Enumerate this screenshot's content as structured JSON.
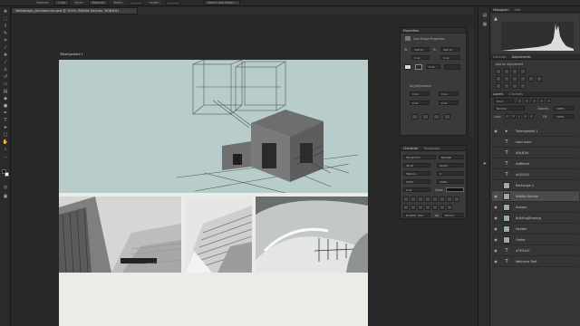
{
  "options_bar": {
    "items": [
      "Feather:",
      "0 px",
      "Style:",
      "Normal",
      "Width:",
      "Height:",
      "Select and Mask..."
    ]
  },
  "document_tab": {
    "title": "Webdesign_Architecture.psd @ 100% (Middle Section, RGB/8#)"
  },
  "canvas": {
    "artboard_label": "Tekengebied 1"
  },
  "properties_panel": {
    "title": "Properties",
    "subtitle": "Live Shape Properties",
    "w_label": "W:",
    "w_value": "340 px",
    "h_label": "H:",
    "h_value": "402 px",
    "x_value": "0 px",
    "y_value": "0 px",
    "stroke_value": "0 px",
    "corner_label": "Any/all/corners",
    "corner_values": [
      "0 px",
      "0 px",
      "0 px",
      "0 px"
    ]
  },
  "character_panel": {
    "tabs": [
      "Character",
      "Paragraph"
    ],
    "font_family": "Myriad Pro",
    "font_style": "Regular",
    "font_size": "36 pt",
    "leading": "(Auto)",
    "kerning": "Metrics",
    "tracking": "0",
    "vertical_scale": "100%",
    "horizontal_scale": "100%",
    "baseline": "0 pt",
    "color_label": "Color:",
    "language": "English: USA",
    "antialias": "Strong",
    "aa_icon": "aa"
  },
  "histogram_panel": {
    "tabs": [
      "Histogram",
      "Info"
    ]
  },
  "libraries_panel": {
    "tabs": [
      "Libraries",
      "Adjustments"
    ],
    "add_label": "Add an adjustment"
  },
  "layers_panel": {
    "tabs": [
      "Layers",
      "Channels"
    ],
    "kind_label": "Kind",
    "blend_mode": "Normal",
    "opacity_label": "Opacity:",
    "opacity_value": "100%",
    "lock_label": "Lock:",
    "fill_label": "Fill:",
    "fill_value": "100%",
    "layers": [
      {
        "name": "Tekengebied 1",
        "type": "group",
        "visible": true
      },
      {
        "name": "read more",
        "type": "text",
        "visible": false
      },
      {
        "name": "#0L81M",
        "type": "text",
        "visible": false
      },
      {
        "name": "#offered",
        "type": "text",
        "visible": false
      },
      {
        "name": "#LOGO0",
        "type": "text",
        "visible": false
      },
      {
        "name": "Rectangle 2",
        "type": "image",
        "visible": false
      },
      {
        "name": "Middle Section",
        "type": "image",
        "visible": true,
        "selected": true
      },
      {
        "name": "Images",
        "type": "image",
        "visible": true
      },
      {
        "name": "BuildingDrawing",
        "type": "image",
        "visible": true
      },
      {
        "name": "Header",
        "type": "image",
        "visible": true
      },
      {
        "name": "Footer",
        "type": "image",
        "visible": true
      },
      {
        "name": "#TE3x2S",
        "type": "text",
        "visible": true
      },
      {
        "name": "Welcome Text",
        "type": "text",
        "visible": true
      }
    ]
  }
}
